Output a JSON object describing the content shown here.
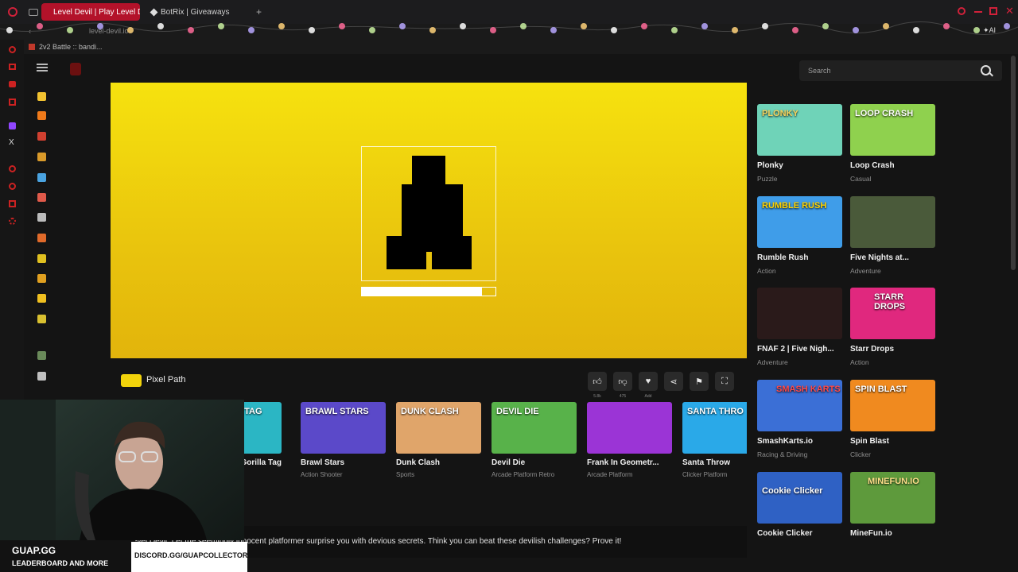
{
  "browser": {
    "tabs": [
      {
        "label": "Level Devil | Play Level De",
        "active": true
      },
      {
        "label": "BotRix | Giveaways",
        "active": false
      }
    ],
    "new_tab": "+",
    "url": "level-devil.io",
    "bookmark": "2v2 Battle :: bandi..."
  },
  "search": {
    "placeholder": "Search"
  },
  "game": {
    "title": "Pixel Path",
    "progress_fraction": 0.9,
    "likes": "5.8k",
    "dislikes": "475",
    "favorite_label": "Add"
  },
  "carousel": [
    {
      "name": "Gorilla Tag",
      "thumb_text": "GORILLA TAG",
      "tags": "",
      "color": "#2bb6c4"
    },
    {
      "name": "Brawl Stars",
      "thumb_text": "BRAWL STARS",
      "tags": "Action  Shooter",
      "color": "#5b49c9"
    },
    {
      "name": "Dunk Clash",
      "thumb_text": "DUNK CLASH",
      "tags": "Sports",
      "color": "#e0a56a"
    },
    {
      "name": "Devil Die",
      "thumb_text": "DEVIL DIE",
      "tags": "Arcade  Platform  Retro",
      "color": "#58b24a"
    },
    {
      "name": "Frank In Geometr...",
      "thumb_text": "",
      "tags": "Arcade  Platform",
      "color": "#9b34d6"
    },
    {
      "name": "Santa Throw",
      "thumb_text": "SANTA THRO",
      "tags": "Clicker  Platform",
      "color": "#2aa9e8"
    }
  ],
  "grid": [
    {
      "name": "Plonky",
      "tag": "Puzzle",
      "thumb_text": "PLONKY",
      "color": "#6fd3b8"
    },
    {
      "name": "Loop Crash",
      "tag": "Casual",
      "thumb_text": "LOOP CRASH",
      "color": "#8fd14e"
    },
    {
      "name": "Rumble Rush",
      "tag": "Action",
      "thumb_text": "RUMBLE RUSH",
      "color": "#3f9de9"
    },
    {
      "name": "Five Nights at...",
      "tag": "Adventure",
      "thumb_text": "",
      "color": "#4a5a3a"
    },
    {
      "name": "FNAF 2 | Five Nigh...",
      "tag": "Adventure",
      "thumb_text": "",
      "color": "#2a1a1a"
    },
    {
      "name": "Starr Drops",
      "tag": "Action",
      "thumb_text": "STARR DROPS",
      "color": "#e0287e"
    },
    {
      "name": "SmashKarts.io",
      "tag": "Racing & Driving",
      "thumb_text": "SMASH KARTS",
      "color": "#3b6fd6"
    },
    {
      "name": "Spin Blast",
      "tag": "Clicker",
      "thumb_text": "SPIN BLAST",
      "color": "#f08a1f"
    },
    {
      "name": "Cookie Clicker",
      "tag": "Clicker",
      "thumb_text": "Cookie Clicker",
      "color": "#2f61c4"
    },
    {
      "name": "MineFun.io",
      "tag": "Adventure",
      "thumb_text": "MINEFUN.IO",
      "color": "#5e9a3c"
    }
  ],
  "description": "Play Level Devil: Let the seemingly innocent platformer surprise you with devious secrets. Think you can beat these devilish challenges? Prove it!",
  "overlay": {
    "title": "GUAP.GG",
    "subtitle": "LEADERBOARD AND MORE",
    "discord": "DISCORD.GG/GUAPCOLLECTOR"
  }
}
